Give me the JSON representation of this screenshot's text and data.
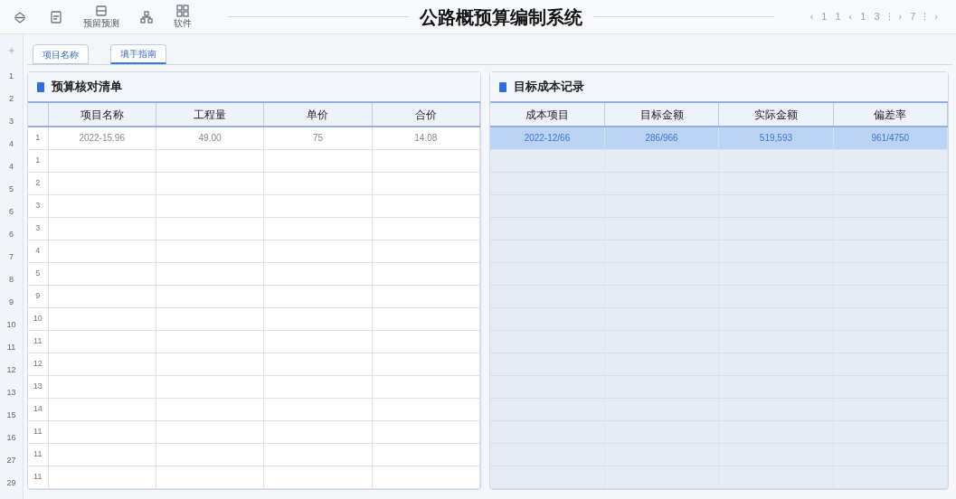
{
  "toolbar": {
    "items": [
      {
        "kind": "icon"
      },
      {
        "kind": "icon"
      },
      {
        "kind": "labeled",
        "label": "预留预测"
      },
      {
        "kind": "icon"
      },
      {
        "kind": "labeled",
        "label": "软件"
      }
    ]
  },
  "window": {
    "title": "公路概预算编制系统"
  },
  "pager": [
    "‹",
    "1",
    "1",
    "‹",
    "1",
    "3",
    "⁝",
    "›",
    "7",
    "⁝",
    "›"
  ],
  "gutter": [
    "1",
    "2",
    "3",
    "4",
    "4",
    "5",
    "6",
    "6",
    "7",
    "8",
    "9",
    "10",
    "11",
    "12",
    "13",
    "15",
    "16",
    "27",
    "29"
  ],
  "tabs": [
    {
      "label": "项目名称",
      "selected": false
    },
    {
      "label": "填手指南",
      "selected": true
    }
  ],
  "budget_table": {
    "title": "预算核对清单",
    "columns": [
      "项目名称",
      "工程量",
      "单价",
      "合价"
    ],
    "rows": [
      {
        "index": "1",
        "cells": [
          "2022-15.96",
          "49.00",
          "75",
          "14.08"
        ]
      },
      {
        "index": "1",
        "cells": []
      },
      {
        "index": "2",
        "cells": []
      },
      {
        "index": "3",
        "cells": []
      },
      {
        "index": "3",
        "cells": []
      },
      {
        "index": "4",
        "cells": []
      },
      {
        "index": "5",
        "cells": []
      },
      {
        "index": "9",
        "cells": []
      },
      {
        "index": "10",
        "cells": []
      },
      {
        "index": "11",
        "cells": []
      },
      {
        "index": "12",
        "cells": []
      },
      {
        "index": "13",
        "cells": []
      },
      {
        "index": "14",
        "cells": []
      },
      {
        "index": "11",
        "cells": []
      },
      {
        "index": "11",
        "cells": []
      },
      {
        "index": "11",
        "cells": []
      }
    ]
  },
  "cost_table": {
    "title": "目标成本记录",
    "columns": [
      "成本项目",
      "目标金额",
      "实际金额",
      "偏差率"
    ],
    "rows": [
      {
        "selected": true,
        "cells": [
          "2022-12/66",
          "286/966",
          "519,593",
          "961/4750"
        ]
      },
      {
        "selected": false,
        "cells": []
      },
      {
        "selected": false,
        "cells": []
      },
      {
        "selected": false,
        "cells": []
      },
      {
        "selected": false,
        "cells": []
      },
      {
        "selected": false,
        "cells": []
      },
      {
        "selected": false,
        "cells": []
      },
      {
        "selected": false,
        "cells": []
      },
      {
        "selected": false,
        "cells": []
      },
      {
        "selected": false,
        "cells": []
      },
      {
        "selected": false,
        "cells": []
      },
      {
        "selected": false,
        "cells": []
      },
      {
        "selected": false,
        "cells": []
      },
      {
        "selected": false,
        "cells": []
      },
      {
        "selected": false,
        "cells": []
      },
      {
        "selected": false,
        "cells": []
      }
    ]
  }
}
